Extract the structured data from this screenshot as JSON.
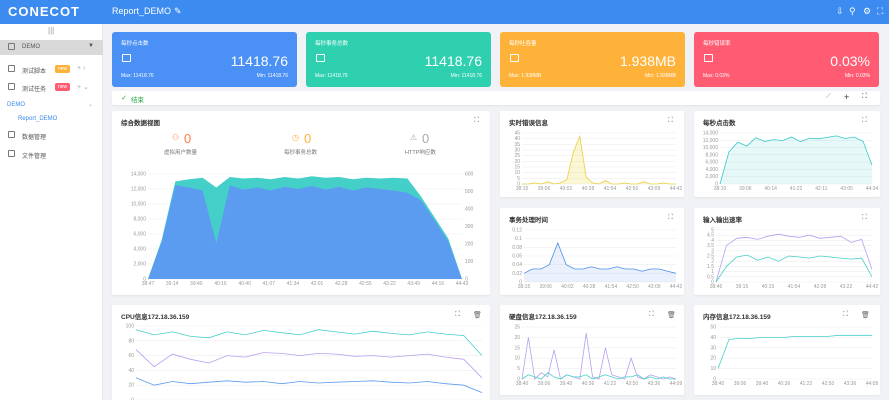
{
  "app": {
    "logo": "CONECOT",
    "title": "Report_DEMO"
  },
  "sidebar": {
    "items": [
      {
        "label": "DEMO"
      },
      {
        "label": "测试脚本",
        "badge": "new"
      },
      {
        "label": "测试任务",
        "badge": "new"
      },
      {
        "label": "DEMO"
      },
      {
        "label": "Report_DEMO"
      },
      {
        "label": "数据管理"
      },
      {
        "label": "文件管理"
      }
    ]
  },
  "kpis": [
    {
      "label": "每秒点击数",
      "value": "11418.76",
      "max": "Max: 11418.76",
      "min": "Min: 11418.76",
      "color": "#4a90f5"
    },
    {
      "label": "每秒事务总数",
      "value": "11418.76",
      "max": "Max: 11418.76",
      "min": "Min: 11418.76",
      "color": "#2ed0b0"
    },
    {
      "label": "每秒吐吞量",
      "value": "1.938MB",
      "max": "Max: 1.938MB",
      "min": "Min: 1.938MB",
      "color": "#ffb23a"
    },
    {
      "label": "每秒错误率",
      "value": "0.03%",
      "max": "Max: 0.03%",
      "min": "Min: 0.03%",
      "color": "#ff5b72"
    }
  ],
  "status": "结束",
  "overview": {
    "title": "综合数据视图",
    "stats": [
      {
        "value": "0",
        "label": "虚拟用户数量"
      },
      {
        "value": "0",
        "label": "每秒事务总数"
      },
      {
        "value": "0",
        "label": "HTTP响应数"
      }
    ]
  },
  "charts": {
    "realtime_errors": "实时错误信息",
    "clicks": "每秒点击数",
    "tx_time": "事务处理时间",
    "io": "输入输出速率",
    "cpu": "CPU信息172.18.36.159",
    "disk": "硬盘信息172.18.36.159",
    "mem": "内存信息172.18.36.159"
  },
  "chart_data": [
    {
      "type": "area",
      "title": "综合数据视图",
      "ylim_left": [
        0,
        14000
      ],
      "ylim_right": [
        0,
        600
      ],
      "y_left_ticks": [
        "0",
        "2,000",
        "4,000",
        "6,000",
        "8,000",
        "10,000",
        "12,000",
        "14,000"
      ],
      "y_right_ticks": [
        "0",
        "100",
        "200",
        "300",
        "400",
        "500",
        "600"
      ],
      "x_ticks": [
        "38:47",
        "39:14",
        "39:40",
        "40:16",
        "40:40",
        "41:07",
        "41:34",
        "42:01",
        "42:28",
        "42:55",
        "43:22",
        "43:49",
        "44:16",
        "44:43"
      ],
      "series": [
        {
          "values": [
            0,
            5200,
            13000,
            13300,
            13500,
            12200,
            13600,
            13400,
            13500,
            13300,
            13600,
            13400,
            13700,
            13500,
            13600,
            13300,
            13500,
            13400,
            13500,
            13400,
            11000,
            8200,
            5400,
            0
          ]
        },
        {
          "values": [
            0,
            5000,
            12500,
            12200,
            11800,
            4800,
            12500,
            11900,
            12200,
            11800,
            12300,
            12000,
            12400,
            11900,
            12300,
            11800,
            12200,
            12000,
            11800,
            11500,
            10500,
            7800,
            5000,
            0
          ]
        }
      ]
    },
    {
      "type": "line",
      "title": "实时错误信息",
      "ylim": [
        0,
        45
      ],
      "y_ticks": [
        "0",
        "5",
        "10",
        "15",
        "20",
        "25",
        "30",
        "35",
        "40",
        "45"
      ],
      "x_ticks": [
        "38:15",
        "39:06",
        "40:02",
        "40:28",
        "41:54",
        "42:50",
        "43:09",
        "44:42"
      ],
      "series": [
        {
          "values": [
            0,
            0,
            1,
            0,
            2,
            0,
            1,
            4,
            28,
            42,
            6,
            1,
            0,
            3,
            0,
            0,
            1,
            0,
            0,
            2,
            0,
            0,
            1,
            0,
            0
          ]
        }
      ]
    },
    {
      "type": "line",
      "title": "每秒点击数",
      "ylim": [
        0,
        14000
      ],
      "y_ticks": [
        "0",
        "2,000",
        "4,000",
        "6,000",
        "8,000",
        "10,000",
        "12,000",
        "14,000"
      ],
      "x_ticks": [
        "38:10",
        "39:06",
        "40:14",
        "41:22",
        "42:11",
        "43:05",
        "44:34"
      ],
      "series": [
        {
          "values": [
            0,
            8800,
            11500,
            10400,
            12700,
            11700,
            12200,
            11900,
            12900,
            11600,
            12600,
            12400,
            12800,
            13200,
            12500,
            12900,
            11700,
            5200
          ]
        }
      ]
    },
    {
      "type": "line",
      "title": "事务处理时间",
      "ylim": [
        0,
        0.12
      ],
      "y_ticks": [
        "0",
        "0.02",
        "0.04",
        "0.06",
        "0.08",
        "0.1",
        "0.12"
      ],
      "x_ticks": [
        "38:15",
        "39:06",
        "40:02",
        "40:28",
        "41:54",
        "42:50",
        "43:09",
        "44:42"
      ],
      "series": [
        {
          "values": [
            0.02,
            0.03,
            0.03,
            0.04,
            0.09,
            0.04,
            0.03,
            0.03,
            0.035,
            0.03,
            0.03,
            0.035,
            0.03,
            0.03,
            0.025,
            0.03,
            0.03,
            0.025,
            0.02
          ]
        }
      ]
    },
    {
      "type": "line",
      "title": "输入输出速率",
      "ylim": [
        0,
        5
      ],
      "y_ticks": [
        "0",
        "0.5",
        "1",
        "1.5",
        "2",
        "2.5",
        "3",
        "3.5",
        "4",
        "4.5",
        "5"
      ],
      "x_ticks": [
        "38:46",
        "39:15",
        "40:15",
        "41:54",
        "42:28",
        "43:22",
        "44:42"
      ],
      "series": [
        {
          "name": "",
          "values": [
            0,
            3.5,
            4.2,
            4.3,
            4.1,
            4.4,
            4.6,
            4.4,
            4.3,
            4.5,
            4.2,
            4.3,
            4.4,
            3.8,
            4.1,
            1.2
          ]
        },
        {
          "name": "",
          "values": [
            0,
            1.5,
            2.4,
            2.6,
            2.1,
            2.4,
            2.0,
            2.5,
            2.4,
            2.3,
            2.5,
            2.4,
            2.3,
            2.2,
            2.3,
            0.5
          ]
        }
      ]
    },
    {
      "type": "line",
      "title": "CPU信息172.18.36.159",
      "ylim": [
        0,
        100
      ],
      "y_ticks": [
        "0",
        "20",
        "40",
        "60",
        "80",
        "100"
      ],
      "series": [
        {
          "values": [
            95,
            88,
            92,
            86,
            84,
            92,
            88,
            94,
            91,
            88,
            95,
            92,
            89,
            93,
            90,
            88,
            92,
            89,
            87,
            60
          ]
        },
        {
          "values": [
            68,
            45,
            62,
            55,
            50,
            60,
            58,
            64,
            63,
            60,
            63,
            62,
            59,
            60,
            58,
            60,
            62,
            58,
            55,
            30
          ]
        },
        {
          "values": [
            30,
            20,
            25,
            22,
            24,
            26,
            24,
            25,
            22,
            25,
            23,
            24,
            25,
            26,
            24,
            23,
            25,
            22,
            20,
            10
          ]
        }
      ]
    },
    {
      "type": "line",
      "title": "硬盘信息172.18.36.159",
      "ylim": [
        0,
        25
      ],
      "y_ticks": [
        "0",
        "5",
        "10",
        "15",
        "20",
        "25"
      ],
      "x_ticks": [
        "38:40",
        "39:06",
        "39:40",
        "40:36",
        "41:22",
        "42:50",
        "43:36",
        "44:09"
      ],
      "series": [
        {
          "values": [
            0,
            20,
            0,
            3,
            1,
            14,
            0,
            2,
            1,
            0,
            22,
            1,
            0,
            15,
            2,
            1,
            0,
            10,
            1,
            0,
            2,
            1,
            0,
            1,
            0
          ]
        },
        {
          "values": [
            0,
            2,
            1,
            0,
            3,
            1,
            0,
            2,
            1,
            1,
            2,
            0,
            1,
            2,
            1,
            0,
            1,
            1,
            2,
            0,
            1,
            0,
            1,
            0,
            0
          ]
        }
      ]
    },
    {
      "type": "line",
      "title": "内存信息172.18.36.159",
      "ylim": [
        0,
        50
      ],
      "y_ticks": [
        "0",
        "10",
        "20",
        "30",
        "40",
        "50"
      ],
      "x_ticks": [
        "38:40",
        "39:06",
        "39:40",
        "40:36",
        "41:22",
        "42:50",
        "43:36",
        "44:09"
      ],
      "series": [
        {
          "values": [
            10,
            38,
            39,
            39,
            40,
            40,
            40,
            41,
            41,
            41,
            41,
            42,
            42,
            42,
            42
          ]
        }
      ]
    }
  ]
}
